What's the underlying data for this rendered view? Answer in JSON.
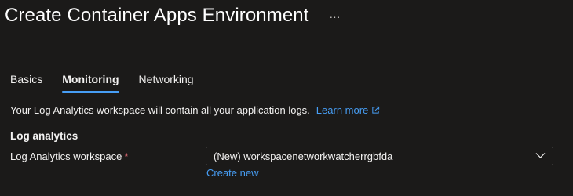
{
  "header": {
    "title": "Create Container Apps Environment",
    "more_label": "···"
  },
  "tabs": [
    {
      "label": "Basics",
      "selected": false
    },
    {
      "label": "Monitoring",
      "selected": true
    },
    {
      "label": "Networking",
      "selected": false
    }
  ],
  "description": {
    "text": "Your Log Analytics workspace will contain all your application logs.",
    "link_label": "Learn more",
    "link_icon": "external-link-icon"
  },
  "section": {
    "title": "Log analytics"
  },
  "workspace_field": {
    "label": "Log Analytics workspace",
    "required_marker": "*",
    "selected_value": "(New) workspacenetworkwatcherrgbfda",
    "dropdown_icon": "chevron-down-icon",
    "create_new_label": "Create new"
  },
  "colors": {
    "background": "#1b1a19",
    "link": "#479ef5",
    "tab_underline": "#479ef5",
    "required": "#f1707b",
    "border": "#8a8886"
  }
}
